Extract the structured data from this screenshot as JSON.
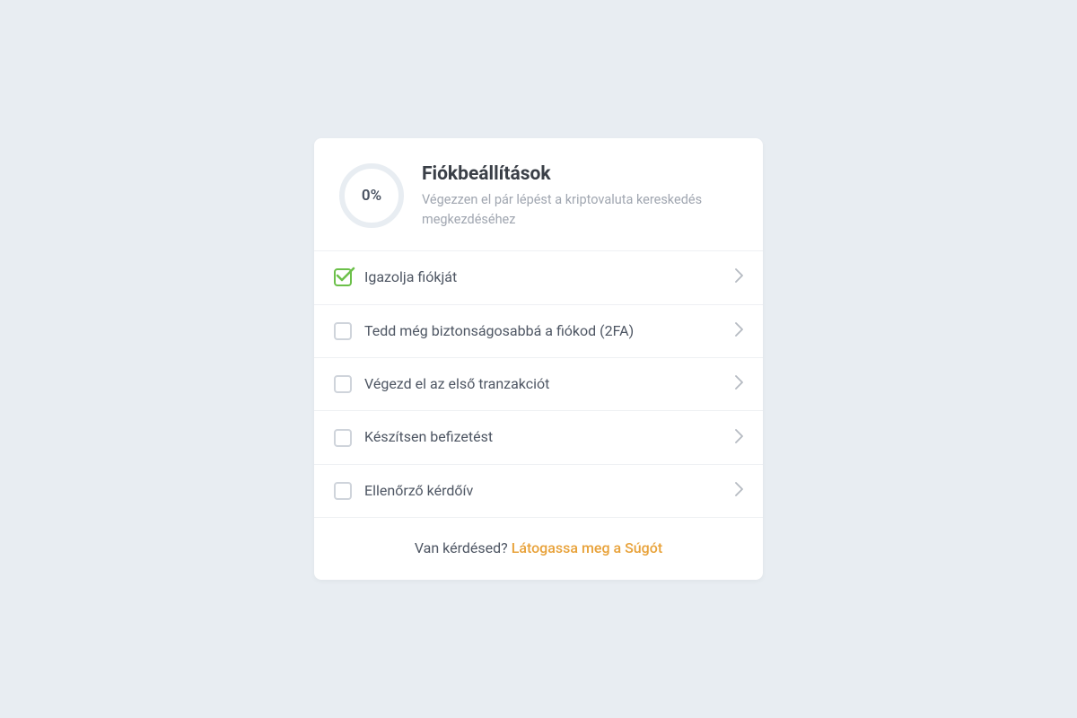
{
  "header": {
    "progress": "0%",
    "title": "Fiókbeállítások",
    "subtitle": "Végezzen el pár lépést a kriptovaluta kereskedés megkezdéséhez"
  },
  "tasks": [
    {
      "label": "Igazolja fiókját",
      "checked": true
    },
    {
      "label": "Tedd még biztonságosabbá a fiókod (2FA)",
      "checked": false
    },
    {
      "label": "Végezd el az első tranzakciót",
      "checked": false
    },
    {
      "label": "Készítsen befizetést",
      "checked": false
    },
    {
      "label": "Ellenőrző kérdőív",
      "checked": false
    }
  ],
  "footer": {
    "question": "Van kérdésed?",
    "link": "Látogassa meg a Súgót"
  }
}
